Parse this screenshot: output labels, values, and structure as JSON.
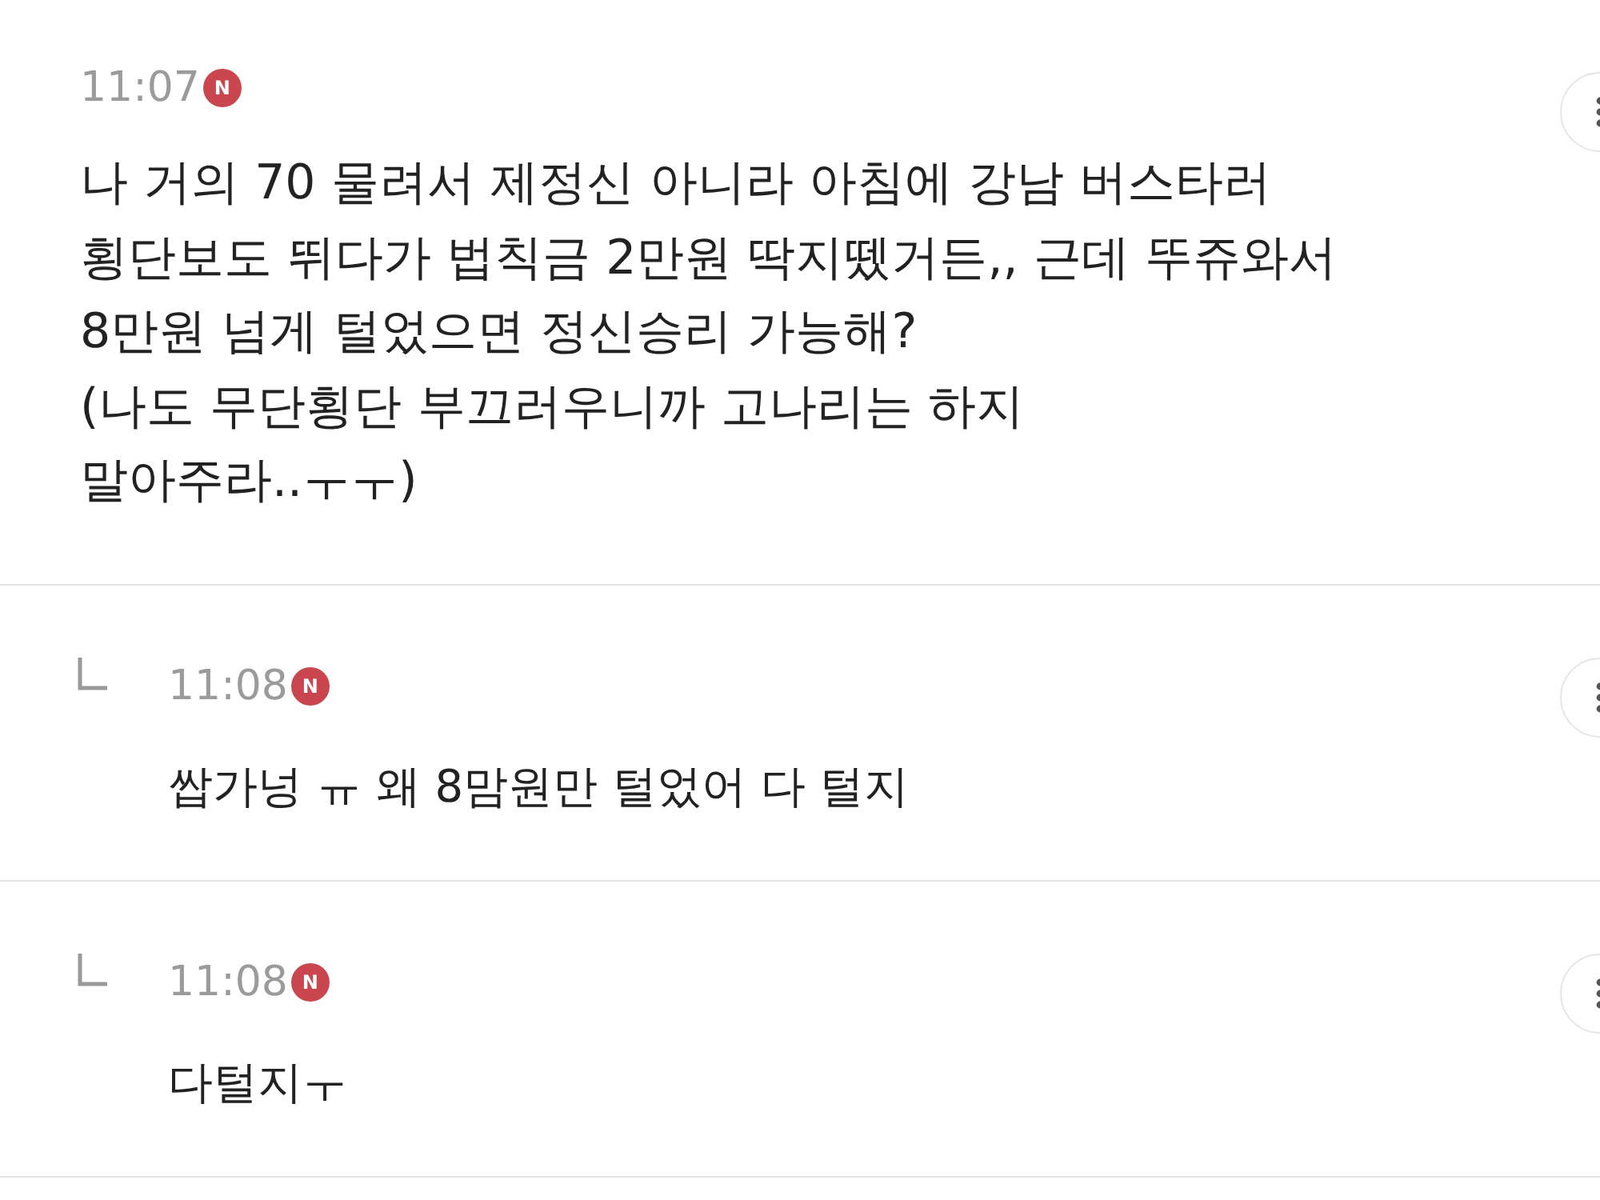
{
  "comments": [
    {
      "kind": "comment",
      "time": "11:07",
      "badge": "N",
      "text": "나 거의 70 물려서 제정신 아니라 아침에 강남 버스타러\n횡단보도 뛰다가 법칙금 2만원 딱지뗐거든,, 근데 뚜쥬와서\n8만원 넘게 털었으면 정신승리 가능해?\n(나도 무단횡단 부끄러우니까 고나리는 하지\n말아주라..ㅜㅜ)"
    },
    {
      "kind": "reply",
      "time": "11:08",
      "badge": "N",
      "text": "쌉가넝 ㅠ 왜 8맘원만 털었어 다 털지"
    },
    {
      "kind": "reply",
      "time": "11:08",
      "badge": "N",
      "text": "다털지ㅜ"
    }
  ]
}
